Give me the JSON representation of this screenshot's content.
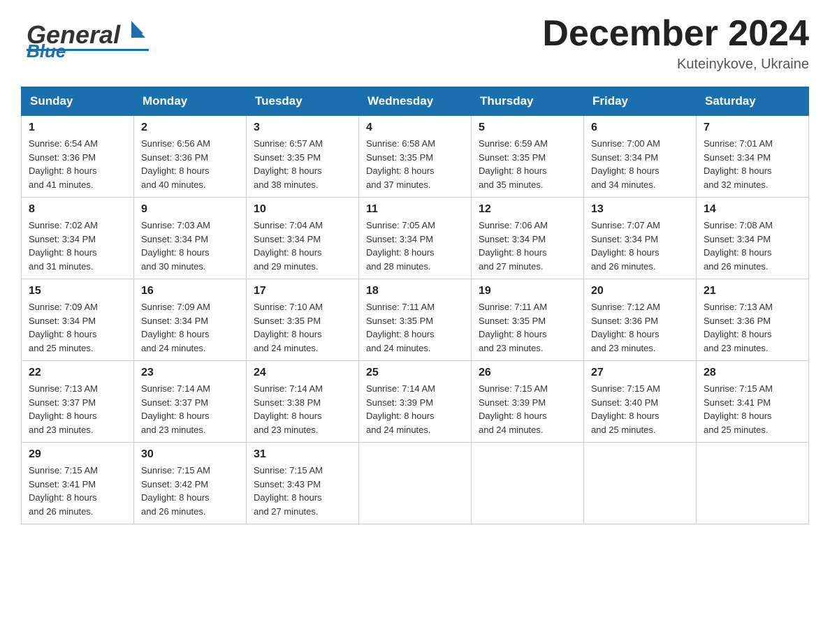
{
  "header": {
    "logo_general": "General",
    "logo_blue": "Blue",
    "month_title": "December 2024",
    "location": "Kuteinykove, Ukraine"
  },
  "calendar": {
    "days_of_week": [
      "Sunday",
      "Monday",
      "Tuesday",
      "Wednesday",
      "Thursday",
      "Friday",
      "Saturday"
    ],
    "weeks": [
      [
        {
          "day": "1",
          "sunrise": "6:54 AM",
          "sunset": "3:36 PM",
          "daylight": "8 hours and 41 minutes."
        },
        {
          "day": "2",
          "sunrise": "6:56 AM",
          "sunset": "3:36 PM",
          "daylight": "8 hours and 40 minutes."
        },
        {
          "day": "3",
          "sunrise": "6:57 AM",
          "sunset": "3:35 PM",
          "daylight": "8 hours and 38 minutes."
        },
        {
          "day": "4",
          "sunrise": "6:58 AM",
          "sunset": "3:35 PM",
          "daylight": "8 hours and 37 minutes."
        },
        {
          "day": "5",
          "sunrise": "6:59 AM",
          "sunset": "3:35 PM",
          "daylight": "8 hours and 35 minutes."
        },
        {
          "day": "6",
          "sunrise": "7:00 AM",
          "sunset": "3:34 PM",
          "daylight": "8 hours and 34 minutes."
        },
        {
          "day": "7",
          "sunrise": "7:01 AM",
          "sunset": "3:34 PM",
          "daylight": "8 hours and 32 minutes."
        }
      ],
      [
        {
          "day": "8",
          "sunrise": "7:02 AM",
          "sunset": "3:34 PM",
          "daylight": "8 hours and 31 minutes."
        },
        {
          "day": "9",
          "sunrise": "7:03 AM",
          "sunset": "3:34 PM",
          "daylight": "8 hours and 30 minutes."
        },
        {
          "day": "10",
          "sunrise": "7:04 AM",
          "sunset": "3:34 PM",
          "daylight": "8 hours and 29 minutes."
        },
        {
          "day": "11",
          "sunrise": "7:05 AM",
          "sunset": "3:34 PM",
          "daylight": "8 hours and 28 minutes."
        },
        {
          "day": "12",
          "sunrise": "7:06 AM",
          "sunset": "3:34 PM",
          "daylight": "8 hours and 27 minutes."
        },
        {
          "day": "13",
          "sunrise": "7:07 AM",
          "sunset": "3:34 PM",
          "daylight": "8 hours and 26 minutes."
        },
        {
          "day": "14",
          "sunrise": "7:08 AM",
          "sunset": "3:34 PM",
          "daylight": "8 hours and 26 minutes."
        }
      ],
      [
        {
          "day": "15",
          "sunrise": "7:09 AM",
          "sunset": "3:34 PM",
          "daylight": "8 hours and 25 minutes."
        },
        {
          "day": "16",
          "sunrise": "7:09 AM",
          "sunset": "3:34 PM",
          "daylight": "8 hours and 24 minutes."
        },
        {
          "day": "17",
          "sunrise": "7:10 AM",
          "sunset": "3:35 PM",
          "daylight": "8 hours and 24 minutes."
        },
        {
          "day": "18",
          "sunrise": "7:11 AM",
          "sunset": "3:35 PM",
          "daylight": "8 hours and 24 minutes."
        },
        {
          "day": "19",
          "sunrise": "7:11 AM",
          "sunset": "3:35 PM",
          "daylight": "8 hours and 23 minutes."
        },
        {
          "day": "20",
          "sunrise": "7:12 AM",
          "sunset": "3:36 PM",
          "daylight": "8 hours and 23 minutes."
        },
        {
          "day": "21",
          "sunrise": "7:13 AM",
          "sunset": "3:36 PM",
          "daylight": "8 hours and 23 minutes."
        }
      ],
      [
        {
          "day": "22",
          "sunrise": "7:13 AM",
          "sunset": "3:37 PM",
          "daylight": "8 hours and 23 minutes."
        },
        {
          "day": "23",
          "sunrise": "7:14 AM",
          "sunset": "3:37 PM",
          "daylight": "8 hours and 23 minutes."
        },
        {
          "day": "24",
          "sunrise": "7:14 AM",
          "sunset": "3:38 PM",
          "daylight": "8 hours and 23 minutes."
        },
        {
          "day": "25",
          "sunrise": "7:14 AM",
          "sunset": "3:39 PM",
          "daylight": "8 hours and 24 minutes."
        },
        {
          "day": "26",
          "sunrise": "7:15 AM",
          "sunset": "3:39 PM",
          "daylight": "8 hours and 24 minutes."
        },
        {
          "day": "27",
          "sunrise": "7:15 AM",
          "sunset": "3:40 PM",
          "daylight": "8 hours and 25 minutes."
        },
        {
          "day": "28",
          "sunrise": "7:15 AM",
          "sunset": "3:41 PM",
          "daylight": "8 hours and 25 minutes."
        }
      ],
      [
        {
          "day": "29",
          "sunrise": "7:15 AM",
          "sunset": "3:41 PM",
          "daylight": "8 hours and 26 minutes."
        },
        {
          "day": "30",
          "sunrise": "7:15 AM",
          "sunset": "3:42 PM",
          "daylight": "8 hours and 26 minutes."
        },
        {
          "day": "31",
          "sunrise": "7:15 AM",
          "sunset": "3:43 PM",
          "daylight": "8 hours and 27 minutes."
        },
        null,
        null,
        null,
        null
      ]
    ],
    "labels": {
      "sunrise": "Sunrise: ",
      "sunset": "Sunset: ",
      "daylight": "Daylight: "
    }
  }
}
